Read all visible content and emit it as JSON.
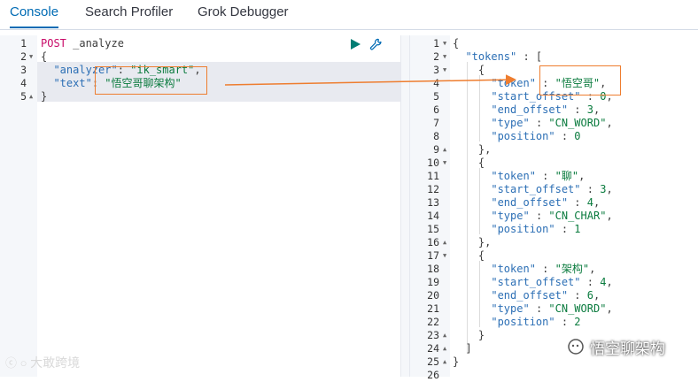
{
  "tabs": [
    {
      "label": "Console"
    },
    {
      "label": "Search Profiler"
    },
    {
      "label": "Grok Debugger"
    }
  ],
  "request": {
    "lines": [
      {
        "n": "1",
        "method": "POST",
        "url": " _analyze"
      },
      {
        "n": "2",
        "text": "{"
      },
      {
        "n": "3",
        "key": "\"analyzer\"",
        "sep": ": ",
        "value": "\"ik_smart\"",
        "trail": ","
      },
      {
        "n": "4",
        "key": "\"text\"",
        "sep": ": ",
        "value": "\"悟空哥聊架构\"",
        "trail": ""
      },
      {
        "n": "5",
        "text": "}"
      }
    ]
  },
  "response": {
    "lines": [
      {
        "n": "1",
        "t": "{"
      },
      {
        "n": "2",
        "t": "  \"tokens\" : ["
      },
      {
        "n": "3",
        "t": "    {"
      },
      {
        "n": "4",
        "t": "      \"token\" : \"悟空哥\","
      },
      {
        "n": "5",
        "t": "      \"start_offset\" : 0,"
      },
      {
        "n": "6",
        "t": "      \"end_offset\" : 3,"
      },
      {
        "n": "7",
        "t": "      \"type\" : \"CN_WORD\","
      },
      {
        "n": "8",
        "t": "      \"position\" : 0"
      },
      {
        "n": "9",
        "t": "    },"
      },
      {
        "n": "10",
        "t": "    {"
      },
      {
        "n": "11",
        "t": "      \"token\" : \"聊\","
      },
      {
        "n": "12",
        "t": "      \"start_offset\" : 3,"
      },
      {
        "n": "13",
        "t": "      \"end_offset\" : 4,"
      },
      {
        "n": "14",
        "t": "      \"type\" : \"CN_CHAR\","
      },
      {
        "n": "15",
        "t": "      \"position\" : 1"
      },
      {
        "n": "16",
        "t": "    },"
      },
      {
        "n": "17",
        "t": "    {"
      },
      {
        "n": "18",
        "t": "      \"token\" : \"架构\","
      },
      {
        "n": "19",
        "t": "      \"start_offset\" : 4,"
      },
      {
        "n": "20",
        "t": "      \"end_offset\" : 6,"
      },
      {
        "n": "21",
        "t": "      \"type\" : \"CN_WORD\","
      },
      {
        "n": "22",
        "t": "      \"position\" : 2"
      },
      {
        "n": "23",
        "t": "    }"
      },
      {
        "n": "24",
        "t": "  ]"
      },
      {
        "n": "25",
        "t": "}"
      },
      {
        "n": "26",
        "t": ""
      }
    ],
    "fold_lines": [
      "1",
      "2",
      "3",
      "9",
      "10",
      "16",
      "17",
      "23",
      "24",
      "25"
    ]
  },
  "watermarks": {
    "left": "大敢跨境",
    "right": "悟空聊架构"
  },
  "colors": {
    "accent": "#006bb4",
    "highlight_box": "#ee7d2f",
    "method": "#c80a68",
    "key": "#2c6fb5",
    "string": "#0a7b3e"
  },
  "icons": {
    "run": "play-icon",
    "settings": "wrench-icon"
  }
}
